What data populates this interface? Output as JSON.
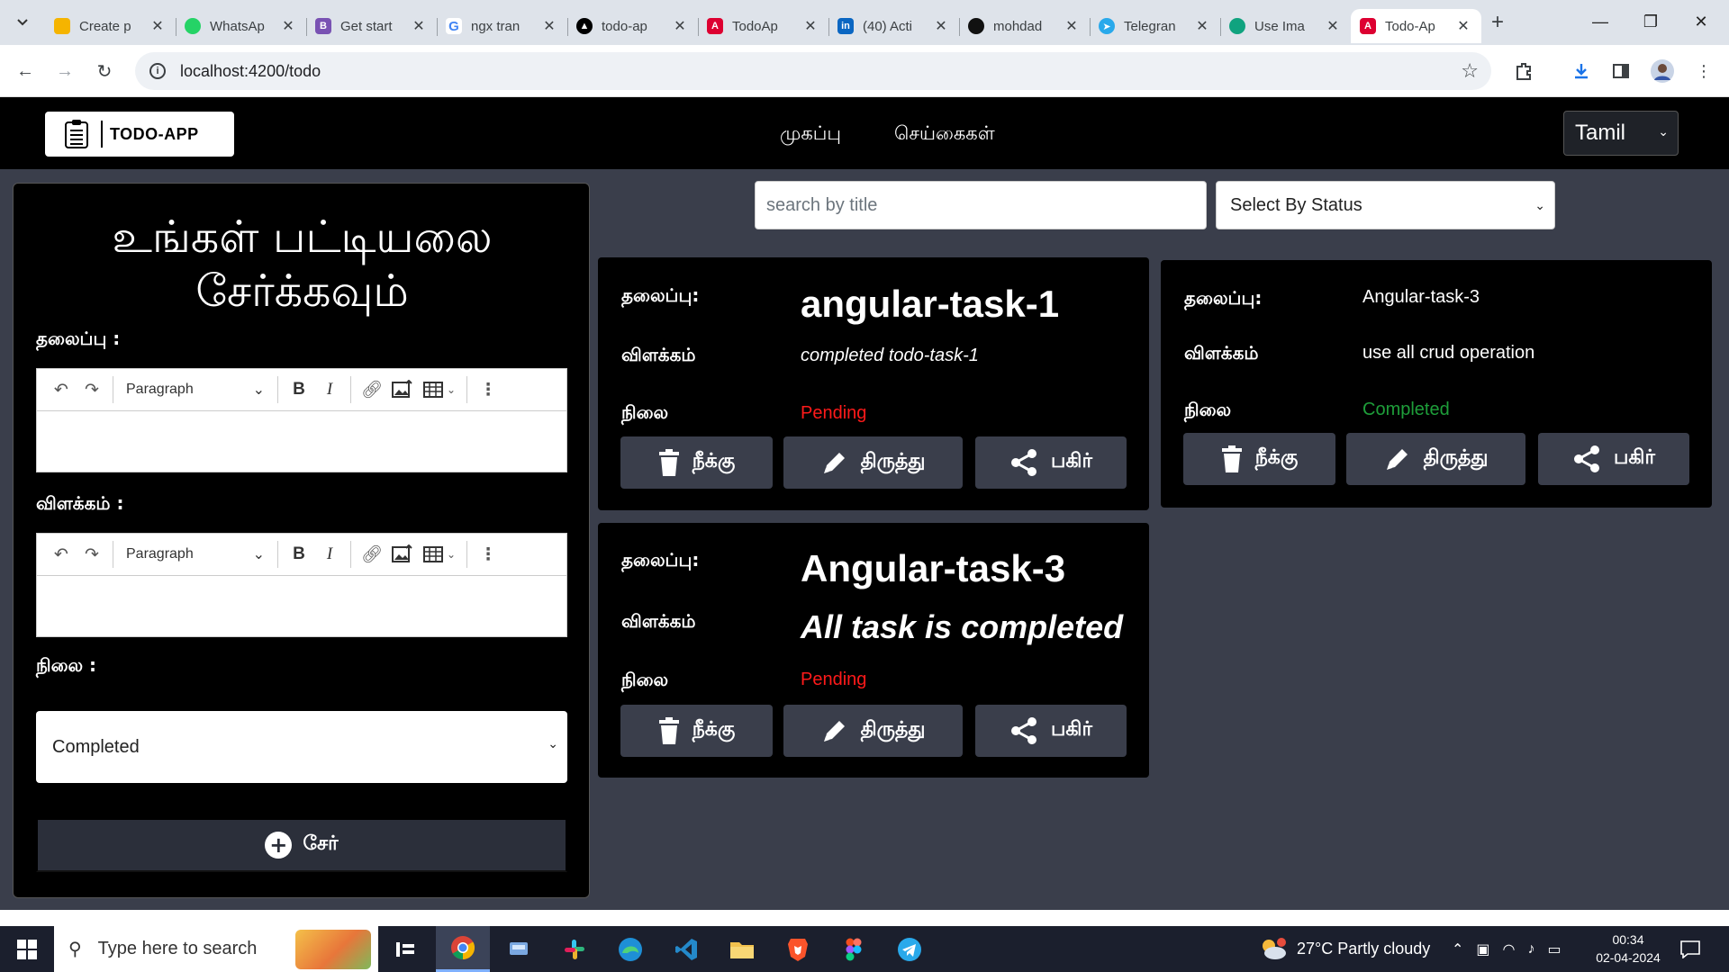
{
  "browser": {
    "tabs": [
      {
        "title": "Create p",
        "favicon": "pencil-icon",
        "color": "#f5b400"
      },
      {
        "title": "WhatsAp",
        "favicon": "whatsapp-icon",
        "color": "#25d366"
      },
      {
        "title": "Get start",
        "favicon": "bootstrap-icon",
        "color": "#7952b3"
      },
      {
        "title": "ngx tran",
        "favicon": "google-icon",
        "color": "#4285f4"
      },
      {
        "title": "todo-ap",
        "favicon": "vercel-icon",
        "color": "#000000"
      },
      {
        "title": "TodoAp",
        "favicon": "angular-icon",
        "color": "#dd0031"
      },
      {
        "title": "(40) Acti",
        "favicon": "linkedin-icon",
        "color": "#0a66c2"
      },
      {
        "title": "mohdad",
        "favicon": "github-icon",
        "color": "#111111"
      },
      {
        "title": "Telegran",
        "favicon": "telegram-icon",
        "color": "#29a9eb"
      },
      {
        "title": "Use Ima",
        "favicon": "chatgpt-icon",
        "color": "#10a37f"
      },
      {
        "title": "Todo-Ap",
        "favicon": "angular-icon",
        "color": "#dd0031",
        "active": true
      }
    ],
    "url": "localhost:4200/todo"
  },
  "navbar": {
    "brand": "TODO-APP",
    "links": [
      "முகப்பு",
      "செய்கைகள்"
    ],
    "language": "Tamil"
  },
  "form": {
    "title_line1": "உங்கள் பட்டியலை",
    "title_line2": "சேர்க்கவும்",
    "title_label": "தலைப்பு :",
    "desc_label": "விளக்கம் :",
    "status_label": "நிலை :",
    "editor_format": "Paragraph",
    "status_value": "Completed",
    "add_button": "சேர்"
  },
  "filters": {
    "search_placeholder": "search by title",
    "status_placeholder": "Select By Status"
  },
  "labels": {
    "title": "தலைப்பு:",
    "description": "விளக்கம்",
    "status": "நிலை",
    "delete": "நீக்கு",
    "edit": "திருத்து",
    "share": "பகிர்"
  },
  "tasks": [
    {
      "title": "angular-task-1",
      "description": "completed todo-task-1",
      "status": "Pending"
    },
    {
      "title": "Angular-task-3",
      "description": "use all crud operation",
      "status": "Completed"
    },
    {
      "title": "Angular-task-3",
      "description": "All task is completed",
      "status": "Pending"
    }
  ],
  "colors": {
    "pending": "#ff1a1a",
    "completed": "#1e9e3a",
    "page_bg": "#3a3e4b"
  },
  "taskbar": {
    "search_placeholder": "Type here to search",
    "weather": "27°C  Partly cloudy",
    "time": "00:34",
    "date": "02-04-2024"
  }
}
